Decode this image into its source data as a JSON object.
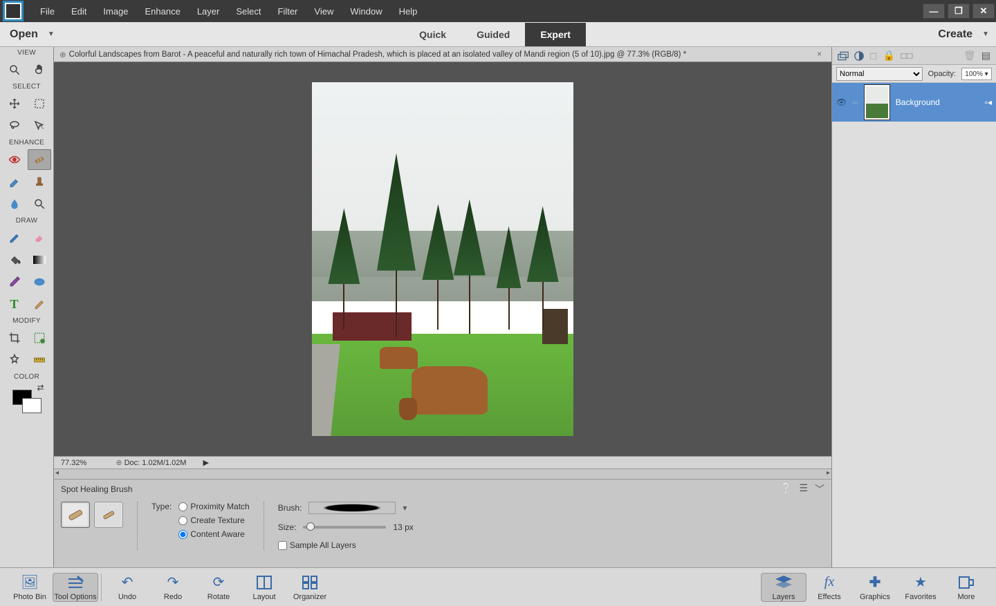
{
  "menu": [
    "File",
    "Edit",
    "Image",
    "Enhance",
    "Layer",
    "Select",
    "Filter",
    "View",
    "Window",
    "Help"
  ],
  "modebar": {
    "open": "Open",
    "quick": "Quick",
    "guided": "Guided",
    "expert": "Expert",
    "create": "Create"
  },
  "document": {
    "tab_title": "Colorful Landscapes from Barot - A peaceful and naturally rich town of Himachal Pradesh, which is placed at an isolated valley of Mandi region (5 of 10).jpg @ 77.3% (RGB/8) *",
    "zoom": "77.32%",
    "doc_size": "Doc: 1.02M/1.02M"
  },
  "toolbox": {
    "sections": {
      "view": "VIEW",
      "select": "SELECT",
      "enhance": "ENHANCE",
      "draw": "DRAW",
      "modify": "MODIFY",
      "color": "COLOR"
    }
  },
  "tool_options": {
    "tool_name": "Spot Healing Brush",
    "type_label": "Type:",
    "types": {
      "proximity": "Proximity Match",
      "texture": "Create Texture",
      "content": "Content Aware"
    },
    "brush_label": "Brush:",
    "size_label": "Size:",
    "size_value": "13 px",
    "sample_all": "Sample All Layers"
  },
  "layers": {
    "blend_mode": "Normal",
    "opacity_label": "Opacity:",
    "opacity_value": "100%",
    "layer_name": "Background"
  },
  "actionbar": {
    "left": [
      "Photo Bin",
      "Tool Options",
      "Undo",
      "Redo",
      "Rotate",
      "Layout",
      "Organizer"
    ],
    "right": [
      "Layers",
      "Effects",
      "Graphics",
      "Favorites",
      "More"
    ]
  }
}
